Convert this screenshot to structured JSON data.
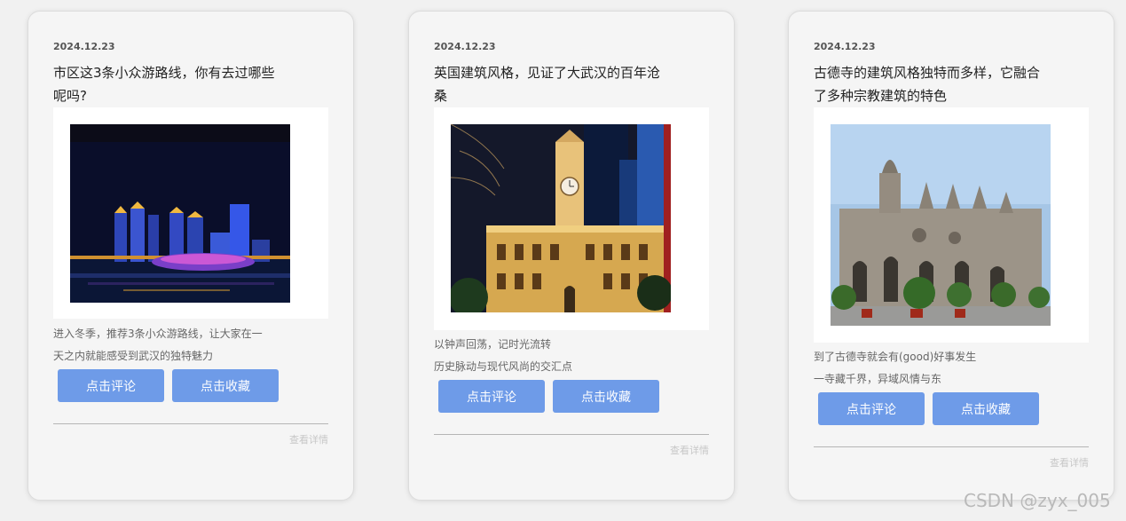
{
  "cards": [
    {
      "date": "2024.12.23",
      "title": "市区这3条小众游路线，你有去过哪些呢吗?",
      "desc_lines": [
        "进入冬季，推荐3条小众游路线，让大家在一",
        "天之内就能感受到武汉的独特魅力"
      ],
      "comment_label": "点击评论",
      "collect_label": "点击收藏",
      "more_label": "查看详情"
    },
    {
      "date": "2024.12.23",
      "title": "英国建筑风格，见证了大武汉的百年沧桑",
      "desc_lines": [
        "以钟声回荡，记时光流转",
        "历史脉动与现代风尚的交汇点"
      ],
      "comment_label": "点击评论",
      "collect_label": "点击收藏",
      "more_label": "查看详情"
    },
    {
      "date": "2024.12.23",
      "title": "古德寺的建筑风格独特而多样，它融合了多种宗教建筑的特色",
      "desc_lines": [
        "到了古德寺就会有(good)好事发生",
        "一寺藏千界，异域风情与东"
      ],
      "comment_label": "点击评论",
      "collect_label": "点击收藏",
      "more_label": "查看详情"
    }
  ],
  "watermark": "CSDN @zyx_005",
  "colors": {
    "button": "#6e9be8",
    "card": "#f5f5f5",
    "page": "#f1f1f1"
  }
}
